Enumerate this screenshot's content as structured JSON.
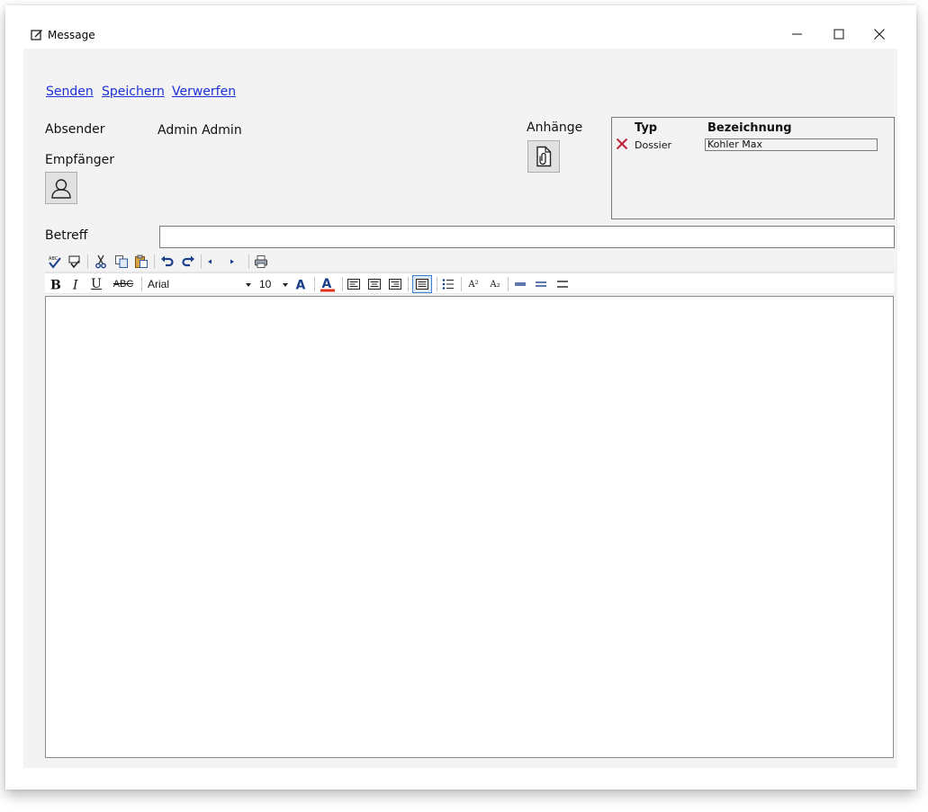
{
  "window": {
    "title": "Message"
  },
  "actions": {
    "send": "Senden",
    "save": "Speichern",
    "discard": "Verwerfen"
  },
  "form": {
    "sender_label": "Absender",
    "sender_value": "Admin Admin",
    "recipient_label": "Empfänger",
    "attachments_label": "Anhänge",
    "subject_label": "Betreff",
    "subject_value": ""
  },
  "attachments": {
    "columns": [
      "Typ",
      "Bezeichnung"
    ],
    "rows": [
      {
        "type": "Dossier",
        "name": "Kohler Max"
      }
    ]
  },
  "editor": {
    "font": "Arial",
    "size": "10",
    "underline_label": "U",
    "strike_label": "ABC",
    "superscript_label": "A²",
    "subscript_label": "A₂",
    "content": ""
  },
  "colors": {
    "link": "#1b32d8",
    "background": "#f3f3f3",
    "remove": "#c0223a"
  }
}
